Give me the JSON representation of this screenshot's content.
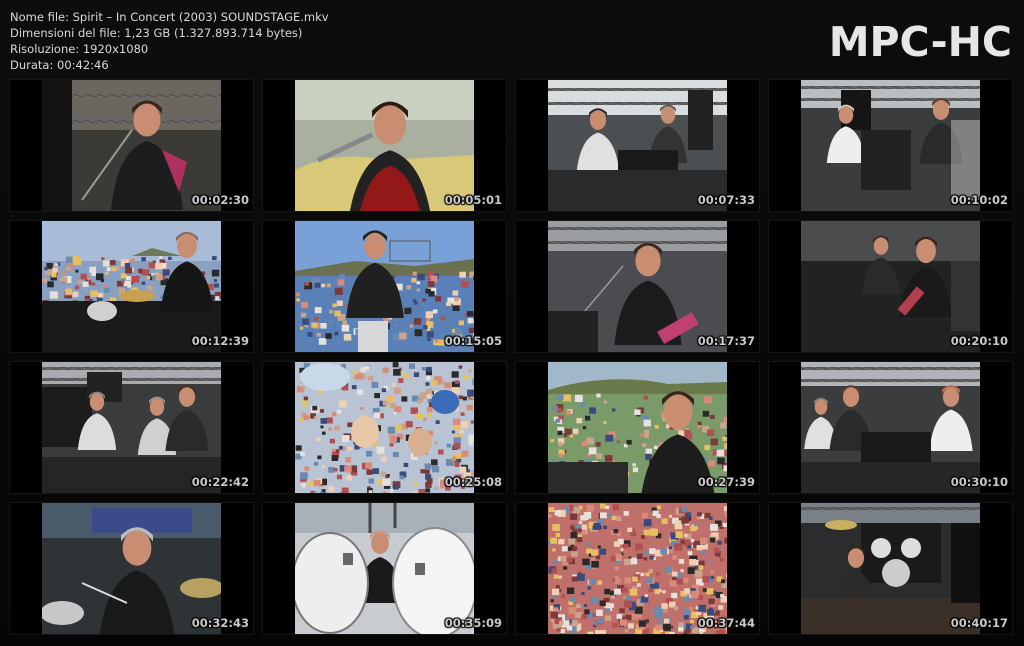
{
  "info": {
    "filename_line": "Nome file: Spirit – In Concert (2003) SOUNDSTAGE.mkv",
    "size_line": "Dimensioni del file: 1,23 GB (1.327.893.714 bytes)",
    "resolution_line": "Risoluzione: 1920x1080",
    "duration_line": "Durata: 00:42:46"
  },
  "logo": "MPC-HC",
  "thumbnails": [
    {
      "time": "00:02:30",
      "scene": "guitarist-closeup"
    },
    {
      "time": "00:05:01",
      "scene": "singer-microphone"
    },
    {
      "time": "00:07:33",
      "scene": "stage-band"
    },
    {
      "time": "00:10:02",
      "scene": "stage-band-rig"
    },
    {
      "time": "00:12:39",
      "scene": "drummer-crowd"
    },
    {
      "time": "00:15:05",
      "scene": "crowd-from-stage"
    },
    {
      "time": "00:17:37",
      "scene": "guitarist-singing"
    },
    {
      "time": "00:20:10",
      "scene": "guitarist-side"
    },
    {
      "time": "00:22:42",
      "scene": "stage-wide"
    },
    {
      "time": "00:25:08",
      "scene": "crowd-closeup"
    },
    {
      "time": "00:27:39",
      "scene": "crowd-field"
    },
    {
      "time": "00:30:10",
      "scene": "stage-wide-2"
    },
    {
      "time": "00:32:43",
      "scene": "drummer-closeup"
    },
    {
      "time": "00:35:09",
      "scene": "drum-kit"
    },
    {
      "time": "00:37:44",
      "scene": "crowd-dense"
    },
    {
      "time": "00:40:17",
      "scene": "stage-drums"
    }
  ]
}
